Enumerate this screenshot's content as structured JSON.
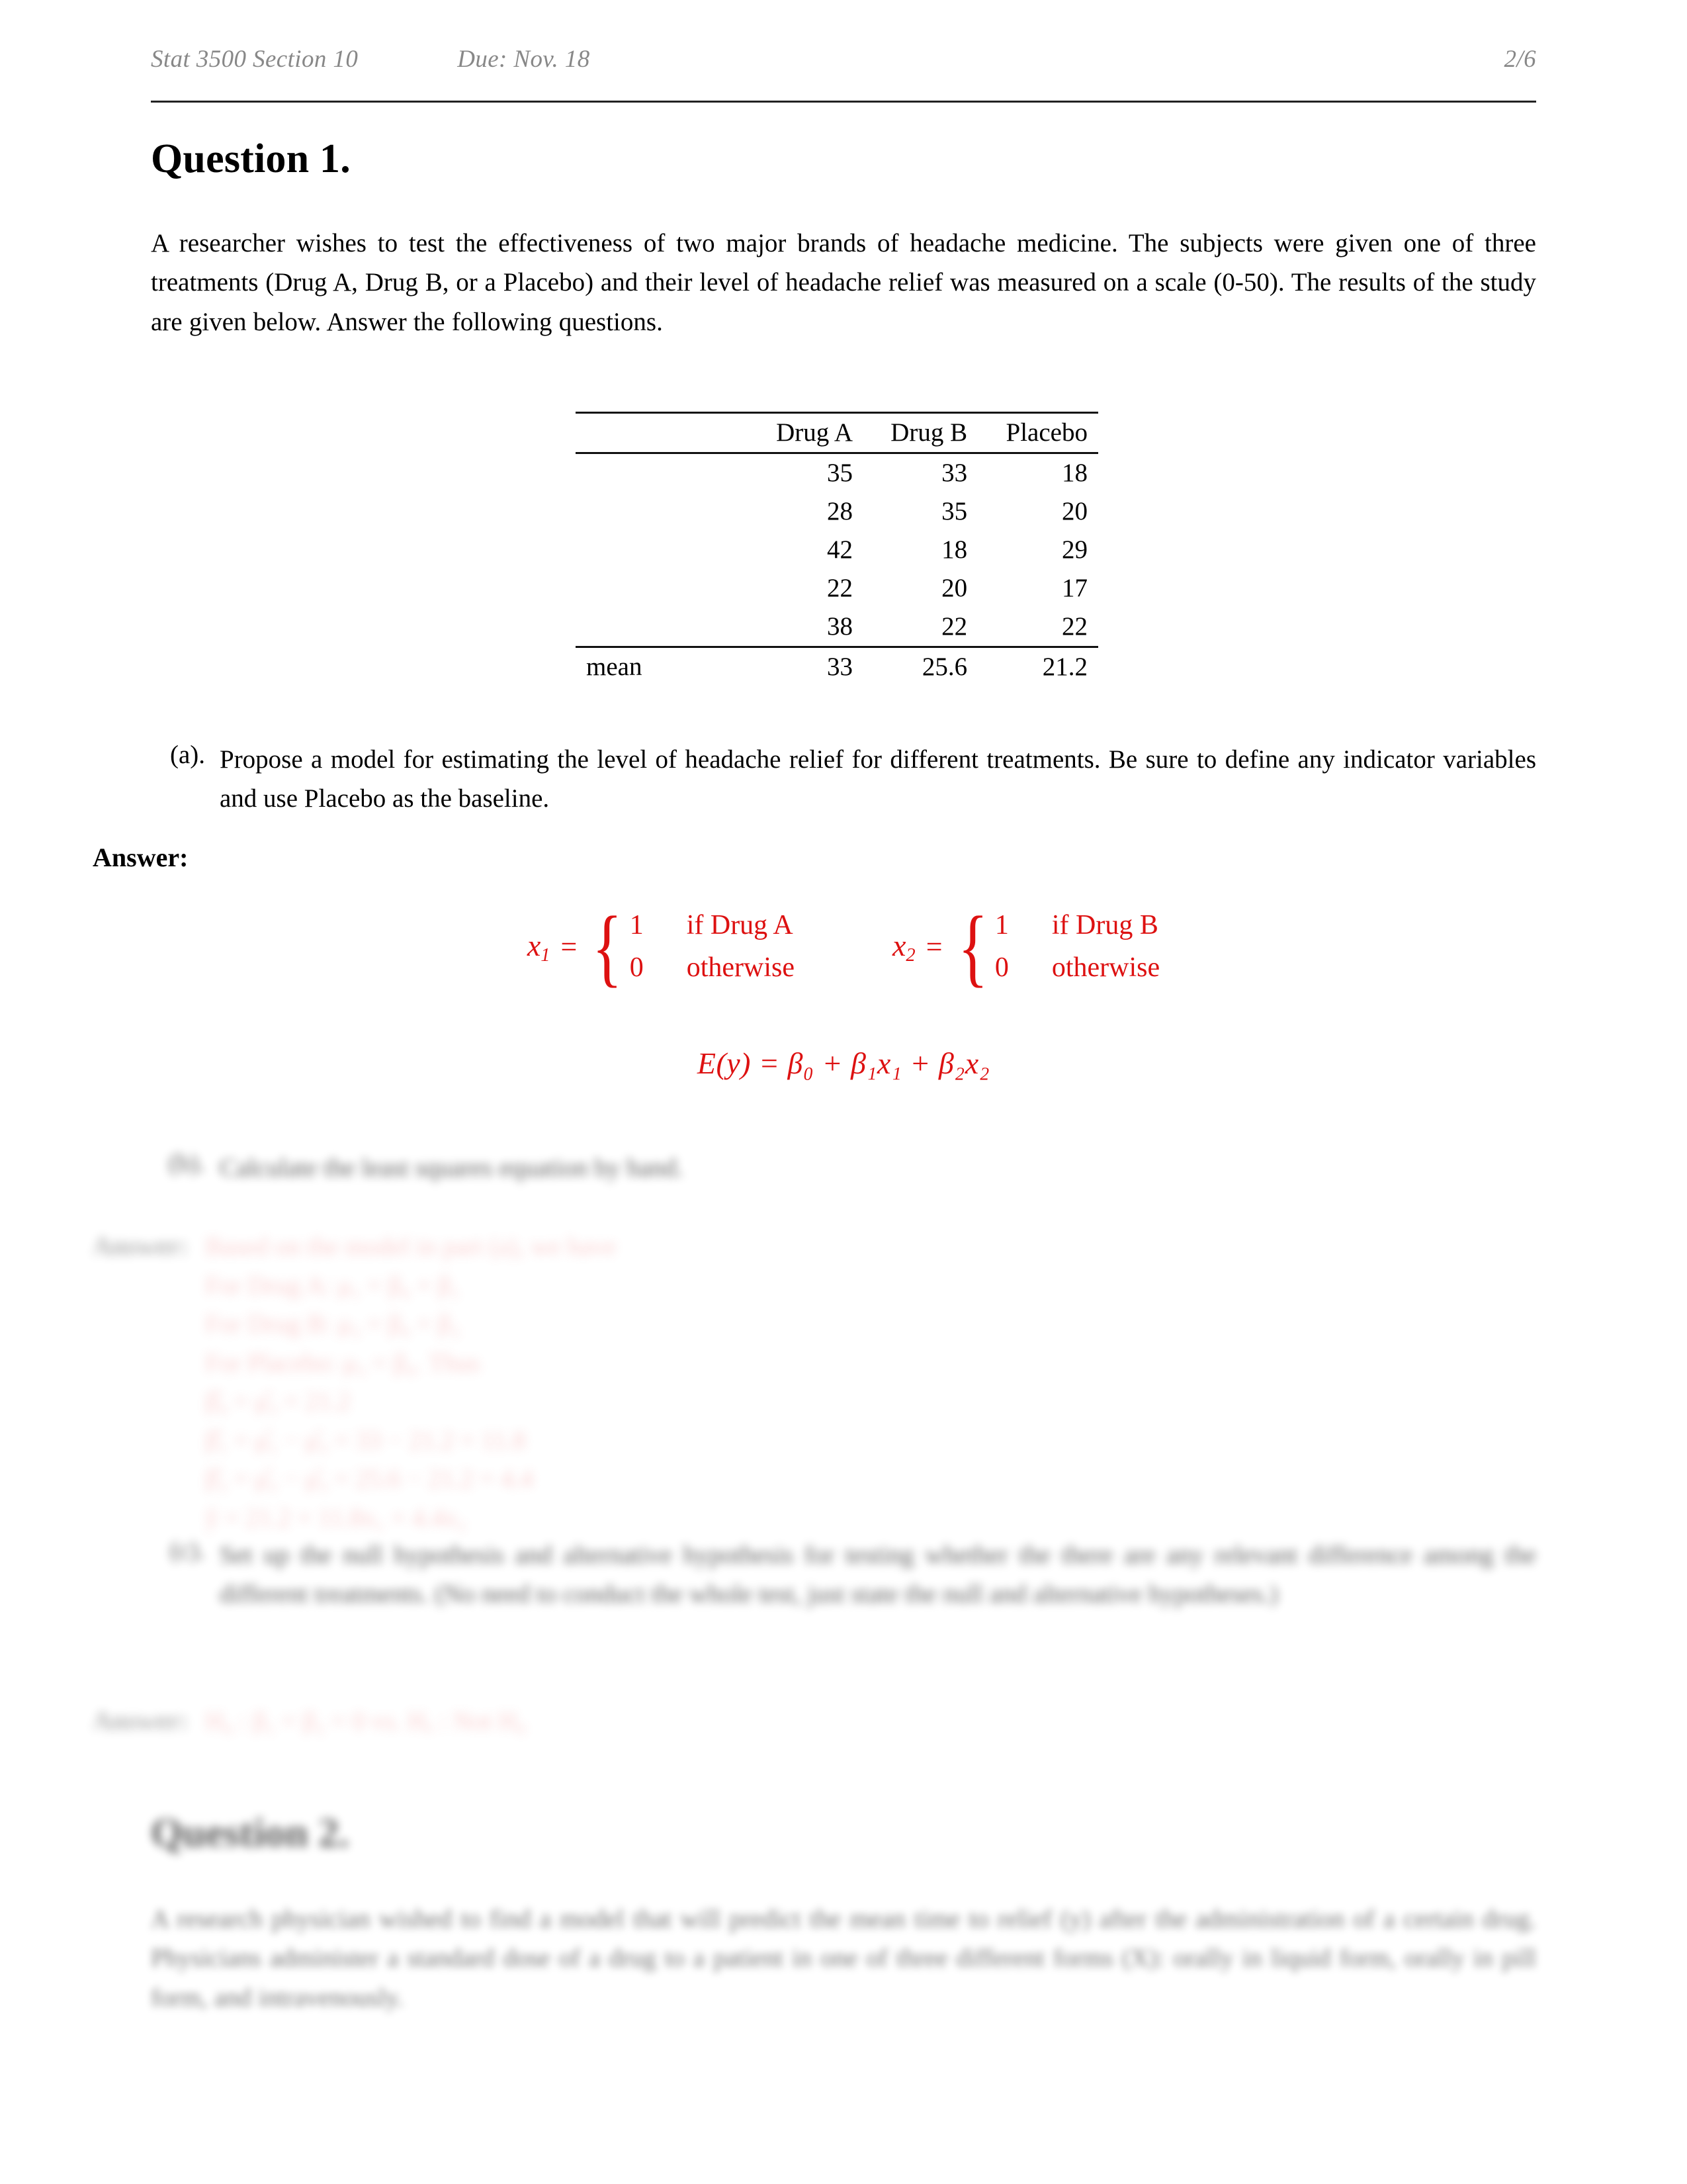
{
  "header": {
    "left": "Stat 3500 Section 10",
    "center": "Due: Nov. 18",
    "right": "2/6"
  },
  "question1": {
    "title": "Question 1.",
    "intro": "A researcher wishes to test the effectiveness of two major brands of headache medicine.  The subjects were given one of three treatments (Drug A, Drug B, or a Placebo) and their level of headache relief was measured on a scale (0-50).  The results of the study are given below. Answer the following questions.",
    "table": {
      "row_label_header": "",
      "columns": [
        "Drug A",
        "Drug B",
        "Placebo"
      ],
      "rows": [
        [
          "",
          "35",
          "33",
          "18"
        ],
        [
          "",
          "28",
          "35",
          "20"
        ],
        [
          "",
          "42",
          "18",
          "29"
        ],
        [
          "",
          "22",
          "20",
          "17"
        ],
        [
          "",
          "38",
          "22",
          "22"
        ]
      ],
      "mean_label": "mean",
      "means": [
        "33",
        "25.6",
        "21.2"
      ]
    },
    "parts": [
      {
        "marker": "(a).",
        "text": "Propose a model for estimating the level of headache relief for different treatments. Be sure to define any indicator variables and use Placebo as the baseline."
      },
      {
        "marker": "(b).",
        "text": "Calculate the least squares equation by hand."
      },
      {
        "marker": "(c).",
        "text": "Set up the null hypothesis and alternative hypothesis for testing whether the there are any relevant difference among the different treatments. (No need to conduct the whole test, just state the null and alternative hypotheses.)"
      }
    ],
    "answer_label": "Answer:",
    "answer_a": {
      "x1_lhs": "x",
      "x1_sub": "1",
      "x1_case1_value": "1",
      "x1_case1_cond": "if Drug A",
      "x1_case2_value": "0",
      "x1_case2_cond": "otherwise",
      "x2_lhs": "x",
      "x2_sub": "2",
      "x2_case1_value": "1",
      "x2_case1_cond": "if Drug B",
      "x2_case2_value": "0",
      "x2_case2_cond": "otherwise",
      "equals": "=",
      "model_equation": "E(y) = β₀ + β₁x₁ + β₂x₂"
    },
    "answer_b": {
      "lines": [
        "Based on the model in part (a), we have",
        "For Drug A: μ₁ = β₀ + β₁",
        "For Drug B: μ₂ = β₀ + β₂",
        "For Placebo: μ₃ = β₀.  Thus",
        "β̂₀ = μ̂₃ = 21.2",
        "β̂₁ = μ̂₁ − μ̂₃ = 33 − 21.2 = 11.8",
        "β̂₂ = μ̂₂ − μ̂₃ = 25.6 − 21.2 = 4.4",
        "ŷ = 21.2 + 11.8x₁ + 4.4x₂"
      ]
    },
    "answer_c": {
      "text": "H₀ : β₁ = β₂ = 0 vs. Hₐ : Not H₀"
    }
  },
  "question2": {
    "title": "Question 2.",
    "intro": "A research physician wished to find a model that will predict the mean time to relief (y) after the administration of a certain drug. Physicians administer a standard dose of a drug to a patient in one of three different forms (X):  orally in liquid form, orally in pill form, and intravenously."
  },
  "colors": {
    "accent_red": "#dd1111",
    "header_gray": "#888888",
    "rule_black": "#222222"
  }
}
